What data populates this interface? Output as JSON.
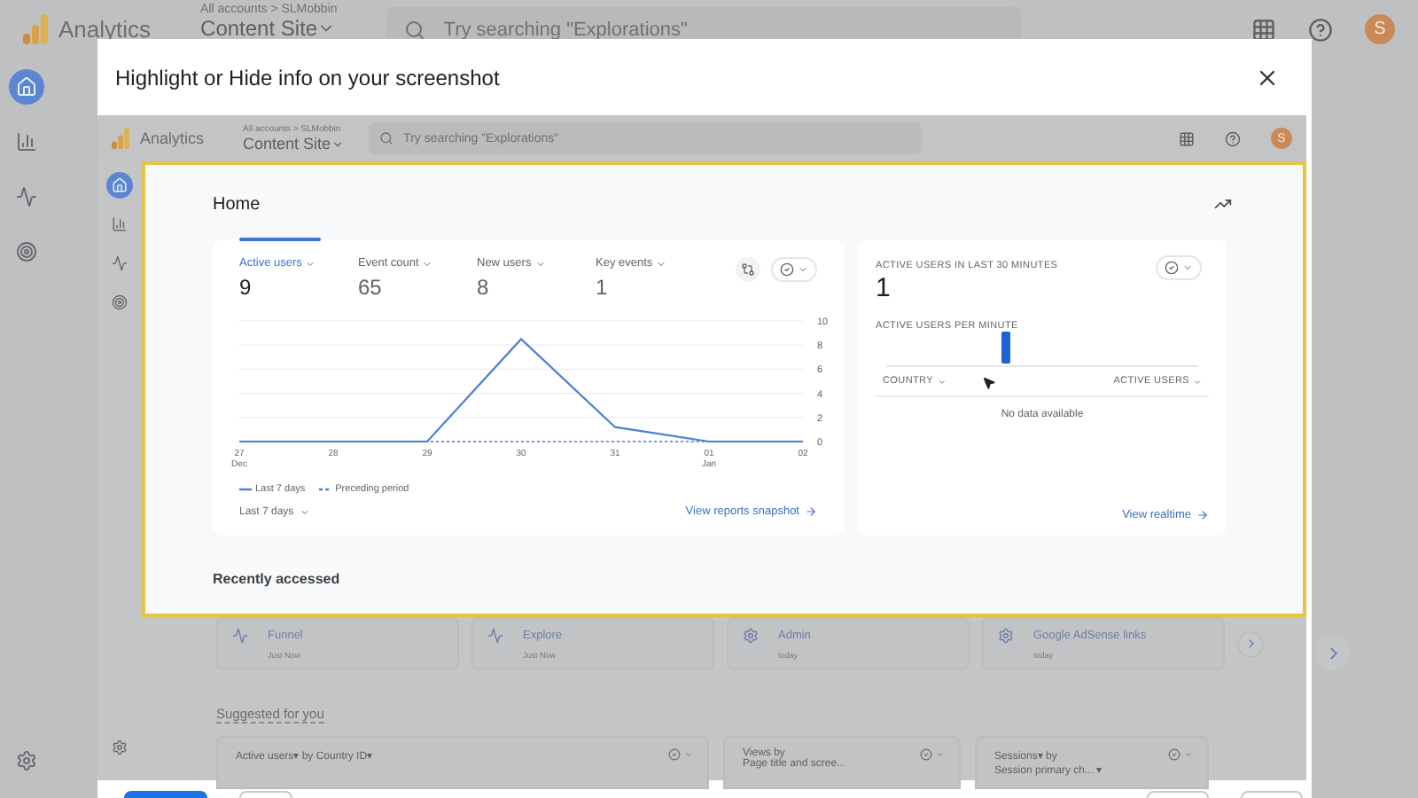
{
  "app": {
    "product": "Analytics",
    "breadcrumb": "All accounts > SLMobbin",
    "property": "Content Site",
    "search": {
      "placeholder": "Try searching \"Explorations\""
    },
    "avatar": "S",
    "rail": [
      {
        "kind": "home",
        "selected": true
      },
      {
        "kind": "reports",
        "selected": false
      },
      {
        "kind": "explore",
        "selected": false
      },
      {
        "kind": "advertising",
        "selected": false
      }
    ]
  },
  "dialog": {
    "title": "Highlight or Hide info on your screenshot",
    "screenshot": {
      "app": {
        "product": "Analytics",
        "breadcrumb": "All accounts > SLMobbin",
        "property": "Content Site",
        "search": {
          "placeholder": "Try searching \"Explorations\""
        },
        "avatar": "S",
        "rail": [
          {
            "kind": "home",
            "selected": true
          },
          {
            "kind": "reports",
            "selected": false
          },
          {
            "kind": "explore",
            "selected": false
          },
          {
            "kind": "advertising",
            "selected": false
          }
        ]
      },
      "page_title": "Home",
      "metrics": [
        {
          "label": "Active users",
          "value": "9",
          "selected": true
        },
        {
          "label": "Event count",
          "value": "65",
          "selected": false
        },
        {
          "label": "New users",
          "value": "8",
          "selected": false
        },
        {
          "label": "Key events",
          "value": "1",
          "selected": false
        }
      ],
      "chart_data": {
        "type": "line",
        "grid": true,
        "categories": [
          "27\nDec",
          "28",
          "29",
          "30",
          "31",
          "01\nJan",
          "02"
        ],
        "ylim": [
          0,
          10
        ],
        "yticks": [
          0,
          2,
          4,
          6,
          8,
          10
        ],
        "series": [
          {
            "name": "Last 7 days",
            "color": "#4a80d6",
            "line_style": "solid",
            "values": [
              0,
              0,
              0,
              8.5,
              1.2,
              0,
              0
            ]
          },
          {
            "name": "Preceding period",
            "color": "#4a80d6",
            "line_style": "dashed",
            "values": [
              0,
              0,
              0,
              0,
              0,
              0,
              0
            ]
          }
        ]
      },
      "date_range": "Last 7 days",
      "report_link": "View reports snapshot",
      "realtime": {
        "title": "ACTIVE USERS IN LAST 30 MINUTES",
        "value": "1",
        "subtitle": "ACTIVE USERS PER MINUTE",
        "columns": [
          "COUNTRY",
          "ACTIVE USERS"
        ],
        "empty": "No data available",
        "link": "View realtime"
      },
      "recently_accessed": {
        "title": "Recently accessed",
        "items": [
          {
            "kind": "explore",
            "name": "Funnel",
            "time": "Just Now"
          },
          {
            "kind": "explore",
            "name": "Explore",
            "time": "Just Now"
          },
          {
            "kind": "admin",
            "name": "Admin",
            "time": "today"
          },
          {
            "kind": "admin",
            "name": "Google AdSense links",
            "time": "today"
          }
        ]
      },
      "suggested": {
        "title": "Suggested for you",
        "cards": [
          {
            "lines": [
              "Active users▾ by Country ID▾"
            ]
          },
          {
            "lines": [
              "Views by",
              "Page title and scree..."
            ]
          },
          {
            "lines": [
              "Sessions▾ by",
              "Session primary ch... ▾"
            ]
          }
        ]
      }
    }
  }
}
